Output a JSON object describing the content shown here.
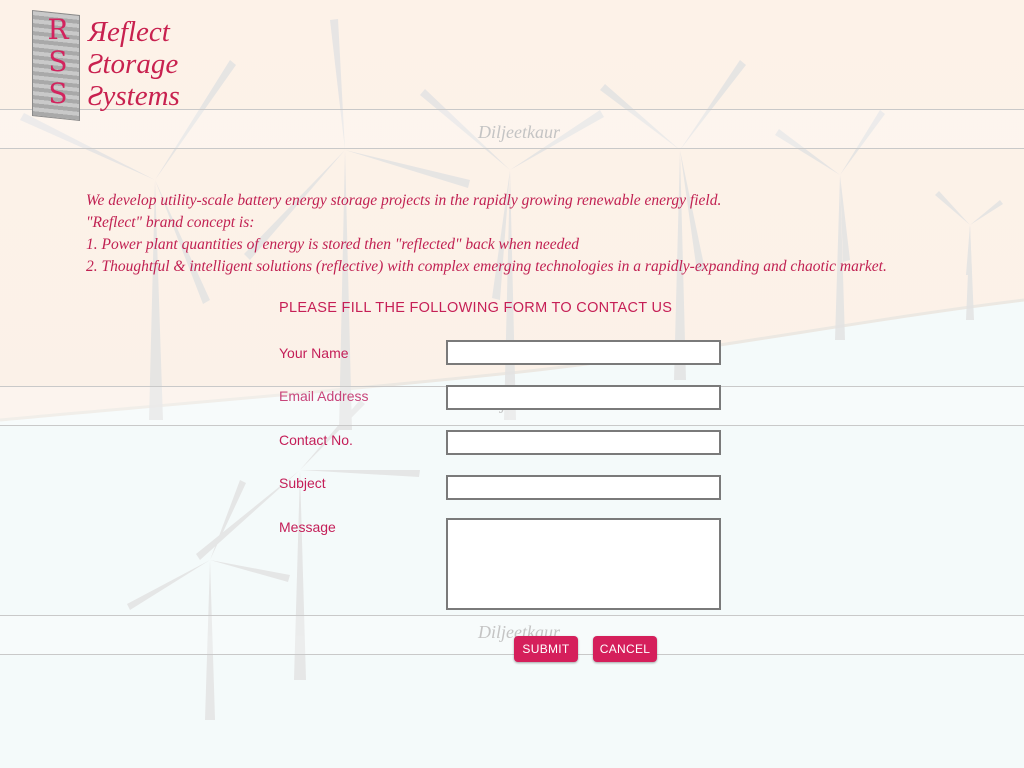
{
  "brand": {
    "logo_letters": [
      "R",
      "S",
      "S"
    ],
    "logo_words": [
      "Яeflect",
      "Ƨtorage",
      "Ƨystems"
    ]
  },
  "watermark": "Diljeetkaur",
  "intro": {
    "lines": [
      "We develop utility-scale battery energy storage projects in the rapidly growing renewable energy field.",
      "\"Reflect\" brand concept is:",
      "1. Power plant quantities of energy is stored then \"reflected\" back when needed",
      "2. Thoughtful & intelligent solutions (reflective) with complex emerging technologies in a rapidly-expanding and chaotic market."
    ]
  },
  "form": {
    "heading": "PLEASE FILL THE FOLLOWING FORM TO CONTACT US",
    "fields": {
      "name": {
        "label": "Your Name",
        "value": ""
      },
      "email": {
        "label": "Email Address",
        "value": ""
      },
      "contact": {
        "label": "Contact No.",
        "value": ""
      },
      "subject": {
        "label": "Subject",
        "value": ""
      },
      "message": {
        "label": "Message",
        "value": ""
      }
    },
    "submit_label": "SUBMIT",
    "cancel_label": "CANCEL"
  },
  "colors": {
    "accent": "#d51f5b",
    "text": "#c41e58",
    "top_background": "#fdf3ea",
    "bottom_background": "#f4fafa"
  }
}
